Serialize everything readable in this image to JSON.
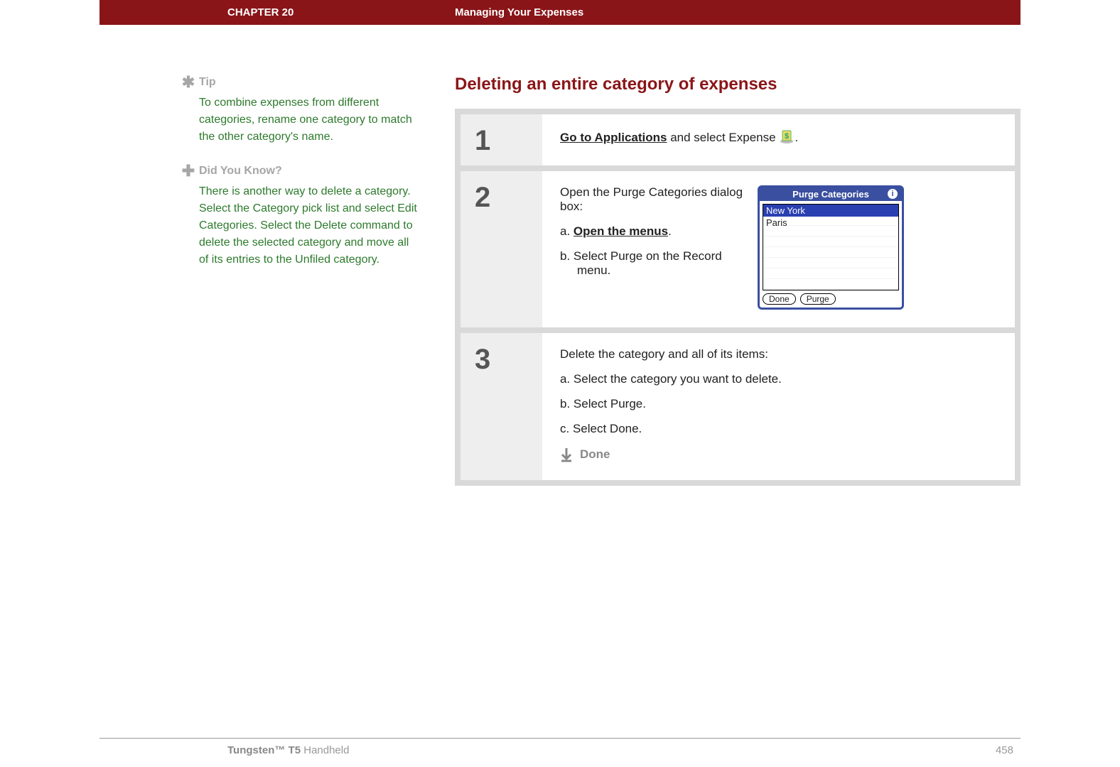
{
  "header": {
    "chapter": "CHAPTER 20",
    "title": "Managing Your Expenses"
  },
  "sidebar": {
    "tip": {
      "icon": "✱",
      "label": "Tip",
      "text": "To combine expenses from different categories, rename one category to match the other category's name."
    },
    "dyk": {
      "icon": "✚",
      "label": "Did You Know?",
      "text": "There is another way to delete a category. Select the Category pick list and select Edit Categories. Select the Delete command to delete the selected category and move all of its entries to the Unfiled category."
    }
  },
  "section_title": "Deleting an entire category of expenses",
  "steps": {
    "s1": {
      "num": "1",
      "link": "Go to Applications",
      "after": " and select Expense ",
      "period": "."
    },
    "s2": {
      "num": "2",
      "lead": "Open the Purge Categories dialog box:",
      "a_prefix": "a.  ",
      "a_link": "Open the menus",
      "a_after": ".",
      "b": "b.  Select Purge on the Record menu."
    },
    "s3": {
      "num": "3",
      "lead": "Delete the category and all of its items:",
      "a": "a.  Select the category you want to delete.",
      "b": "b.  Select Purge.",
      "c": "c.  Select Done.",
      "done": "Done"
    }
  },
  "palm": {
    "title": "Purge Categories",
    "info": "i",
    "items": {
      "i0": "New York",
      "i1": "Paris"
    },
    "btn_done": "Done",
    "btn_purge": "Purge"
  },
  "footer": {
    "product_bold": "Tungsten™ T5",
    "product_rest": " Handheld",
    "page": "458"
  }
}
